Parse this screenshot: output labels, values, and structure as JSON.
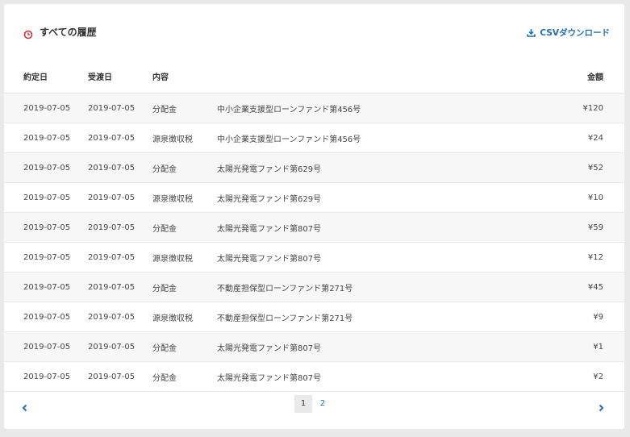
{
  "header": {
    "title": "すべての履歴",
    "csv_label": "CSVダウンロード"
  },
  "table": {
    "columns": [
      "約定日",
      "受渡日",
      "内容",
      "",
      "金額"
    ],
    "rows": [
      {
        "trade_date": "2019-07-05",
        "settle_date": "2019-07-05",
        "type": "分配金",
        "fund": "中小企業支援型ローンファンド第456号",
        "amount": "¥120"
      },
      {
        "trade_date": "2019-07-05",
        "settle_date": "2019-07-05",
        "type": "源泉徴収税",
        "fund": "中小企業支援型ローンファンド第456号",
        "amount": "¥24"
      },
      {
        "trade_date": "2019-07-05",
        "settle_date": "2019-07-05",
        "type": "分配金",
        "fund": "太陽光発電ファンド第629号",
        "amount": "¥52"
      },
      {
        "trade_date": "2019-07-05",
        "settle_date": "2019-07-05",
        "type": "源泉徴収税",
        "fund": "太陽光発電ファンド第629号",
        "amount": "¥10"
      },
      {
        "trade_date": "2019-07-05",
        "settle_date": "2019-07-05",
        "type": "分配金",
        "fund": "太陽光発電ファンド第807号",
        "amount": "¥59"
      },
      {
        "trade_date": "2019-07-05",
        "settle_date": "2019-07-05",
        "type": "源泉徴収税",
        "fund": "太陽光発電ファンド第807号",
        "amount": "¥12"
      },
      {
        "trade_date": "2019-07-05",
        "settle_date": "2019-07-05",
        "type": "分配金",
        "fund": "不動産担保型ローンファンド第271号",
        "amount": "¥45"
      },
      {
        "trade_date": "2019-07-05",
        "settle_date": "2019-07-05",
        "type": "源泉徴収税",
        "fund": "不動産担保型ローンファンド第271号",
        "amount": "¥9"
      },
      {
        "trade_date": "2019-07-05",
        "settle_date": "2019-07-05",
        "type": "分配金",
        "fund": "太陽光発電ファンド第807号",
        "amount": "¥1"
      },
      {
        "trade_date": "2019-07-05",
        "settle_date": "2019-07-05",
        "type": "分配金",
        "fund": "太陽光発電ファンド第807号",
        "amount": "¥2"
      }
    ]
  },
  "pagination": {
    "pages": [
      "1",
      "2"
    ],
    "current": "1"
  },
  "colors": {
    "accent": "#1f6fb8",
    "history_icon": "#d0323c"
  },
  "icons": {
    "title": "history-clock-icon",
    "csv": "download-icon",
    "prev": "chevron-left-icon",
    "next": "chevron-right-icon"
  }
}
